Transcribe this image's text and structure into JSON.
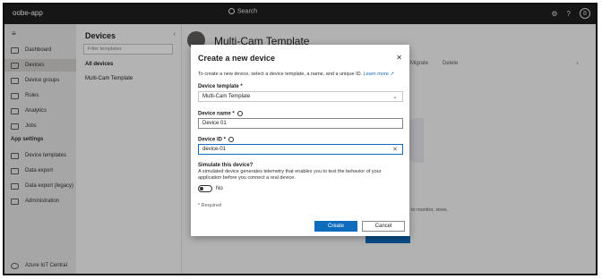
{
  "app": {
    "name": "oobe-app",
    "search_label": "Search",
    "avatar_initial": "8"
  },
  "leftnav": {
    "items": [
      {
        "label": "Dashboard"
      },
      {
        "label": "Devices"
      },
      {
        "label": "Device groups"
      },
      {
        "label": "Rules"
      },
      {
        "label": "Analytics"
      },
      {
        "label": "Jobs"
      }
    ],
    "section": "App settings",
    "settings_items": [
      {
        "label": "Device templates"
      },
      {
        "label": "Data export"
      },
      {
        "label": "Data export (legacy)"
      },
      {
        "label": "Administration"
      }
    ],
    "footer": "Azure IoT Central"
  },
  "devices_panel": {
    "title": "Devices",
    "filter_placeholder": "Filter templates",
    "items": [
      {
        "label": "All devices"
      },
      {
        "label": "Multi-Cam Template"
      }
    ]
  },
  "main": {
    "title": "Multi-Cam Template",
    "cmd_migrate": "Migrate",
    "cmd_delete": "Delete",
    "bg_text": "to monitor, store,"
  },
  "dialog": {
    "title": "Create a new device",
    "intro": "To create a new device, select a device template, a name, and a unique ID.",
    "learn_more": "Learn more",
    "template_label": "Device template *",
    "template_value": "Multi-Cam Template",
    "name_label": "Device name *",
    "name_value": "Device 01",
    "id_label": "Device ID *",
    "id_value": "device-01",
    "simulate_label": "Simulate this device?",
    "simulate_desc": "A simulated device generates telemetry that enables you to test the behavior of your application before you connect a real device.",
    "toggle_value": "No",
    "required_note": "* Required",
    "create_label": "Create",
    "cancel_label": "Cancel"
  }
}
